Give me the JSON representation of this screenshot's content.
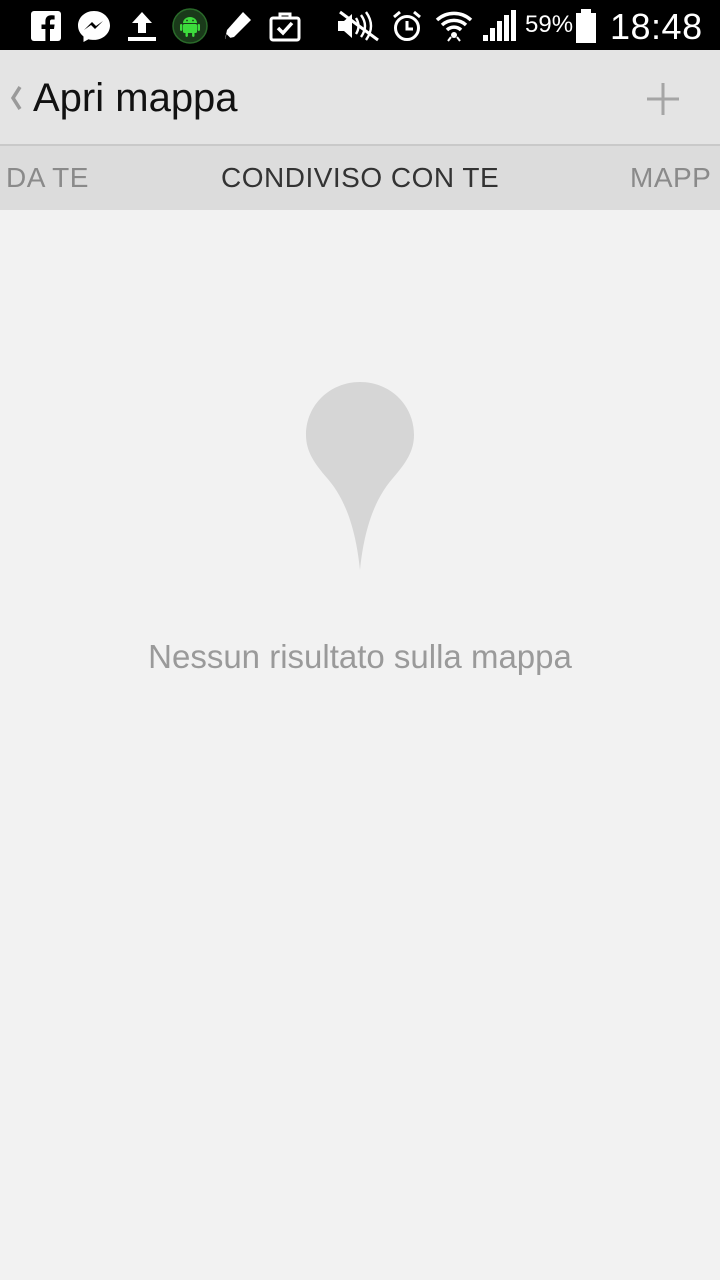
{
  "status_bar": {
    "battery_percent": "59%",
    "time": "18:48",
    "left_icons": [
      "facebook-icon",
      "messenger-icon",
      "upload-icon",
      "android-icon",
      "pencil-icon",
      "briefcase-check-icon"
    ],
    "right_icons": [
      "mute-icon",
      "alarm-icon",
      "wifi-icon",
      "signal-icon",
      "battery-icon"
    ]
  },
  "action_bar": {
    "title": "Apri mappa",
    "add_icon": "plus-icon"
  },
  "tabs": {
    "left": "DA TE",
    "center": "CONDIVISO CON TE",
    "right": "MAPP"
  },
  "empty_state": {
    "icon": "map-pin-icon",
    "message": "Nessun risultato sulla mappa"
  },
  "colors": {
    "status_bar_bg": "#000000",
    "action_bar_bg": "#e4e4e4",
    "tabs_bg": "#dcdcdc",
    "content_bg": "#f2f2f2",
    "pin_color": "#d6d6d6",
    "android_green": "#3ddc3d"
  }
}
